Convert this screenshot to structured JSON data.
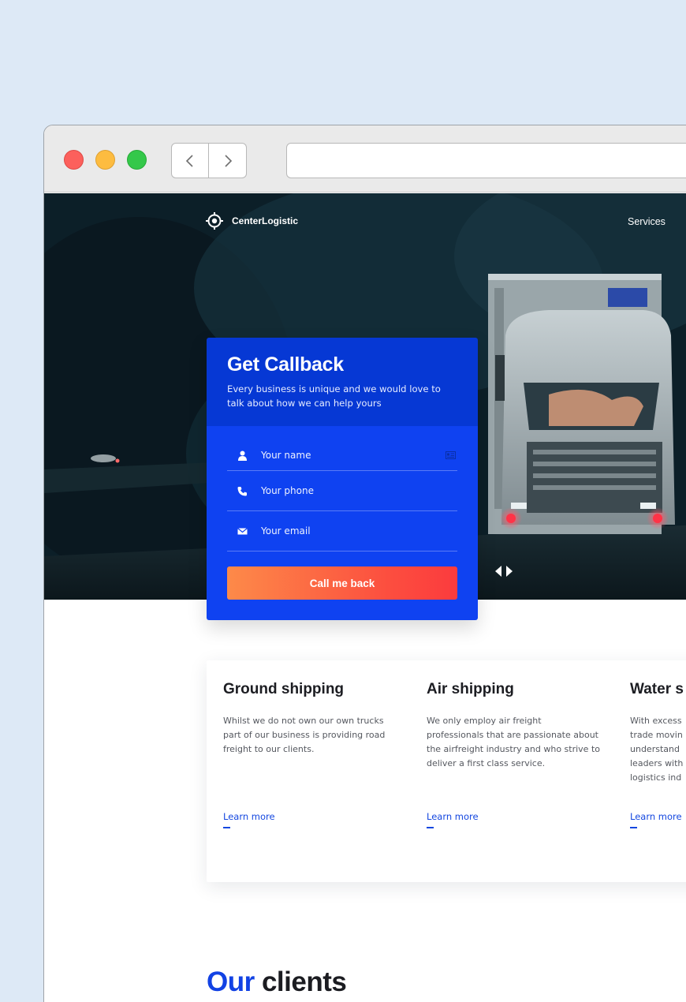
{
  "brand": {
    "name": "CenterLogistic"
  },
  "nav": {
    "services_label": "Services"
  },
  "callback": {
    "title": "Get Callback",
    "subtitle": "Every business is unique and we would love to talk about how we can help yours",
    "fields": [
      {
        "label": "Your name",
        "icon": "person-icon"
      },
      {
        "label": "Your phone",
        "icon": "phone-icon"
      },
      {
        "label": "Your email",
        "icon": "envelope-icon"
      }
    ],
    "button_label": "Call me back"
  },
  "services": [
    {
      "title": "Ground shipping",
      "description": "Whilst we do not own our own trucks part of our business is providing road freight to our clients.",
      "link_label": "Learn more"
    },
    {
      "title": "Air shipping",
      "description": "We only employ air freight professionals that are passionate about the airfreight industry and who strive to deliver a first class service.",
      "link_label": "Learn more"
    },
    {
      "title": "Water s",
      "description": "With excess trade movin understand leaders with logistics ind",
      "link_label": "Learn more"
    }
  ],
  "clients_heading": {
    "accent": "Our",
    "rest": "clients"
  },
  "colors": {
    "primary_blue": "#0f42f1",
    "dark_blue": "#0638d4",
    "button_gradient_start": "#fd8a49",
    "button_gradient_end": "#fb3b3e",
    "link_blue": "#1447e0"
  }
}
